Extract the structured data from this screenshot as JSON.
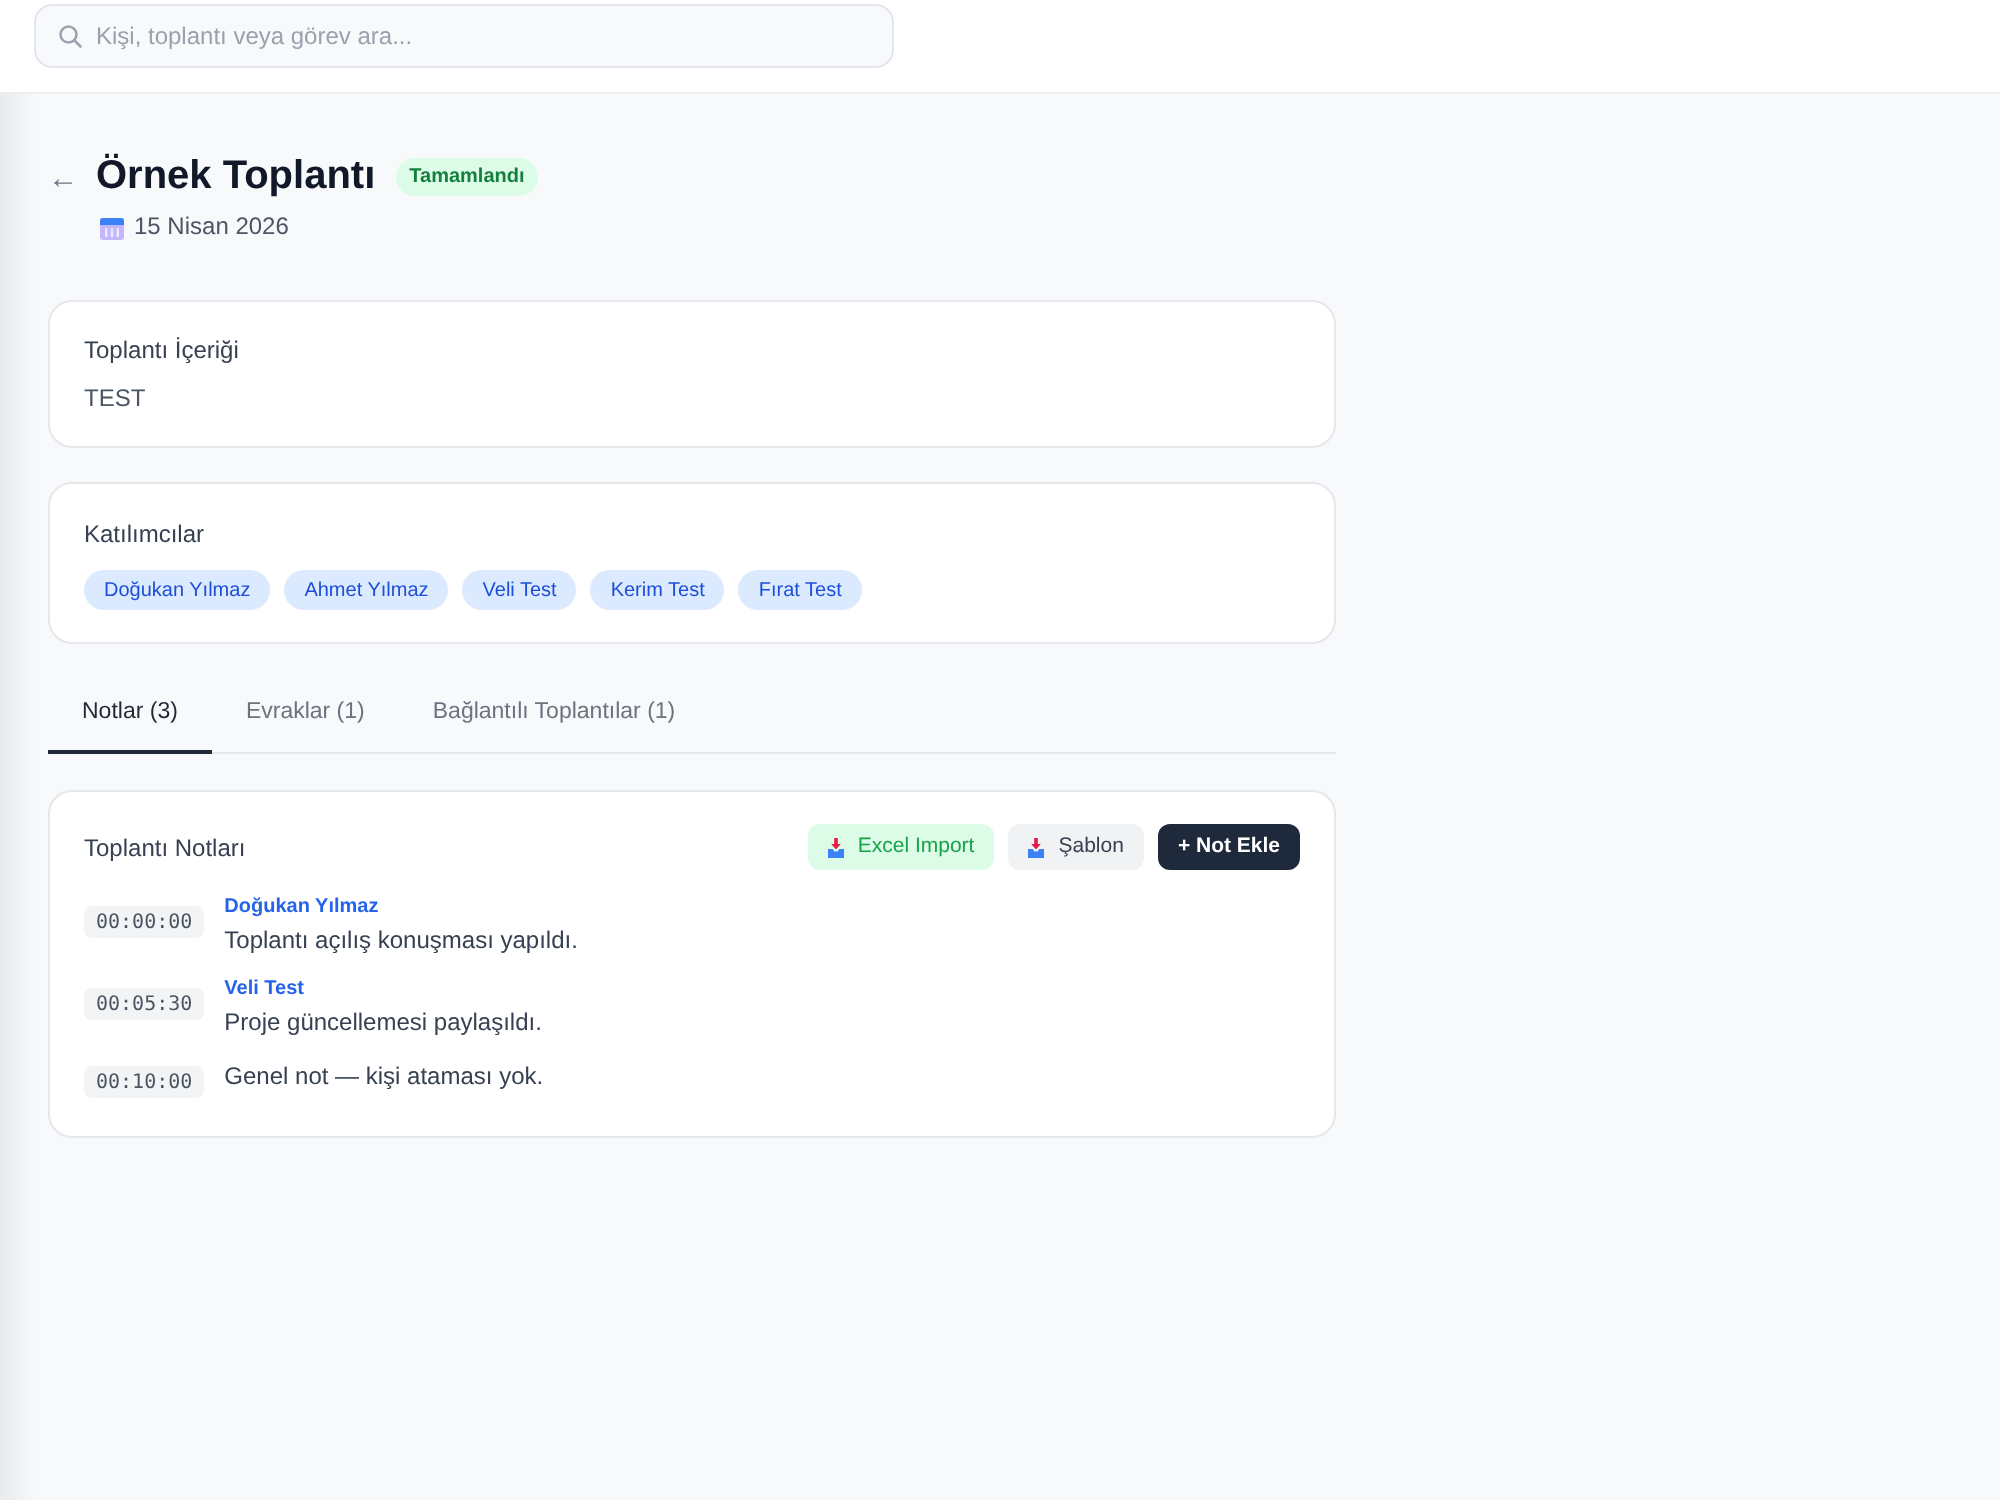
{
  "search": {
    "placeholder": "Kişi, toplantı veya görev ara..."
  },
  "header": {
    "back": "←",
    "title": "Örnek Toplantı",
    "status": {
      "kind": "done",
      "label": "Tamamlandı"
    },
    "date": "15 Nisan 2026"
  },
  "content_card": {
    "title": "Toplantı İçeriği",
    "body": "TEST"
  },
  "participants": {
    "title": "Katılımcılar",
    "people": [
      "Doğukan Yılmaz",
      "Ahmet Yılmaz",
      "Veli Test",
      "Kerim Test",
      "Fırat Test"
    ]
  },
  "tabs": [
    {
      "label": "Notlar (3)",
      "selected": true
    },
    {
      "label": "Evraklar (1)",
      "selected": false
    },
    {
      "label": "Bağlantılı Toplantılar (1)",
      "selected": false
    }
  ],
  "notes_panel": {
    "title": "Toplantı Notları",
    "buttons": [
      {
        "kind": "import",
        "label": "Excel Import"
      },
      {
        "kind": "template",
        "label": "Şablon"
      },
      {
        "kind": "primary",
        "label": "+ Not Ekle"
      }
    ],
    "notes": [
      {
        "time": "00:00:00",
        "author": "Doğukan Yılmaz",
        "text": "Toplantı açılış konuşması yapıldı."
      },
      {
        "time": "00:05:30",
        "author": "Veli Test",
        "text": "Proje güncellemesi paylaşıldı."
      },
      {
        "time": "00:10:00",
        "text": "Genel not — kişi ataması yok."
      }
    ]
  }
}
